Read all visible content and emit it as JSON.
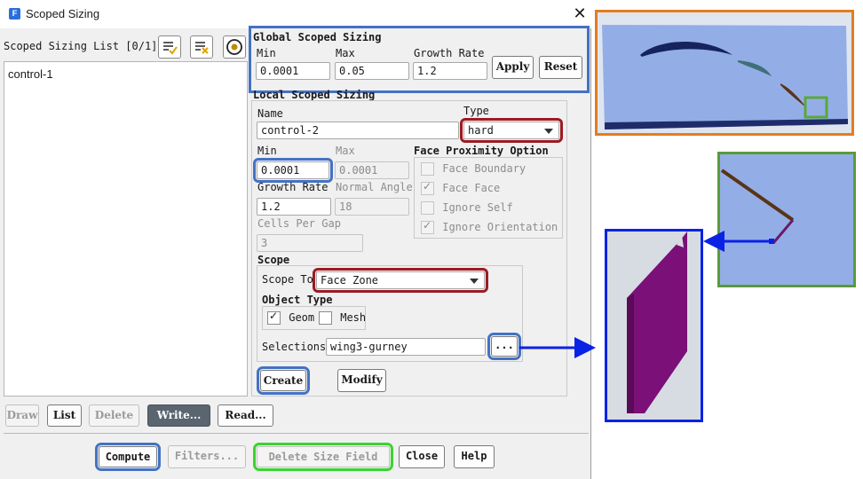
{
  "window": {
    "title": "Scoped Sizing",
    "app_icon": "F"
  },
  "list_panel": {
    "title": "Scoped Sizing List [0/1]",
    "items": [
      "control-1"
    ]
  },
  "global": {
    "title": "Global Scoped Sizing",
    "min_label": "Min",
    "min_value": "0.0001",
    "max_label": "Max",
    "max_value": "0.05",
    "growth_label": "Growth Rate",
    "growth_value": "1.2",
    "apply_label": "Apply",
    "reset_label": "Reset"
  },
  "local": {
    "title": "Local Scoped Sizing",
    "name_label": "Name",
    "name_value": "control-2",
    "type_label": "Type",
    "type_value": "hard",
    "min_label": "Min",
    "min_value": "0.0001",
    "max_label": "Max",
    "max_value": "0.0001",
    "growth_label": "Growth Rate",
    "growth_value": "1.2",
    "normal_angle_label": "Normal Angle",
    "normal_angle_value": "18",
    "cells_gap_label": "Cells Per Gap",
    "cells_gap_value": "3",
    "proximity": {
      "title": "Face Proximity Option",
      "options": [
        {
          "label": "Face Boundary",
          "checked": false
        },
        {
          "label": "Face Face",
          "checked": true
        },
        {
          "label": "Ignore Self",
          "checked": false
        },
        {
          "label": "Ignore Orientation",
          "checked": true
        }
      ]
    },
    "scope": {
      "title": "Scope",
      "scope_to_label": "Scope To",
      "scope_to_value": "Face Zone",
      "object_type_title": "Object Type",
      "geom_label": "Geom",
      "geom_checked": true,
      "mesh_label": "Mesh",
      "mesh_checked": false,
      "selections_label": "Selections",
      "selections_value": "wing3-gurney",
      "browse_label": "..."
    },
    "create_label": "Create",
    "modify_label": "Modify"
  },
  "list_buttons": {
    "draw": "Draw",
    "list": "List",
    "delete": "Delete",
    "write": "Write...",
    "read": "Read..."
  },
  "footer": {
    "compute": "Compute",
    "filters": "Filters...",
    "delete_size_field": "Delete Size Field",
    "close": "Close",
    "help": "Help"
  },
  "colors": {
    "highlight_blue": "#4472c4",
    "highlight_red": "#9b1c22",
    "highlight_green": "#3ad42e",
    "arrow_blue": "#0a22e6",
    "viewport_bg": "#93aee6",
    "gurney_purple": "#7a1078"
  }
}
